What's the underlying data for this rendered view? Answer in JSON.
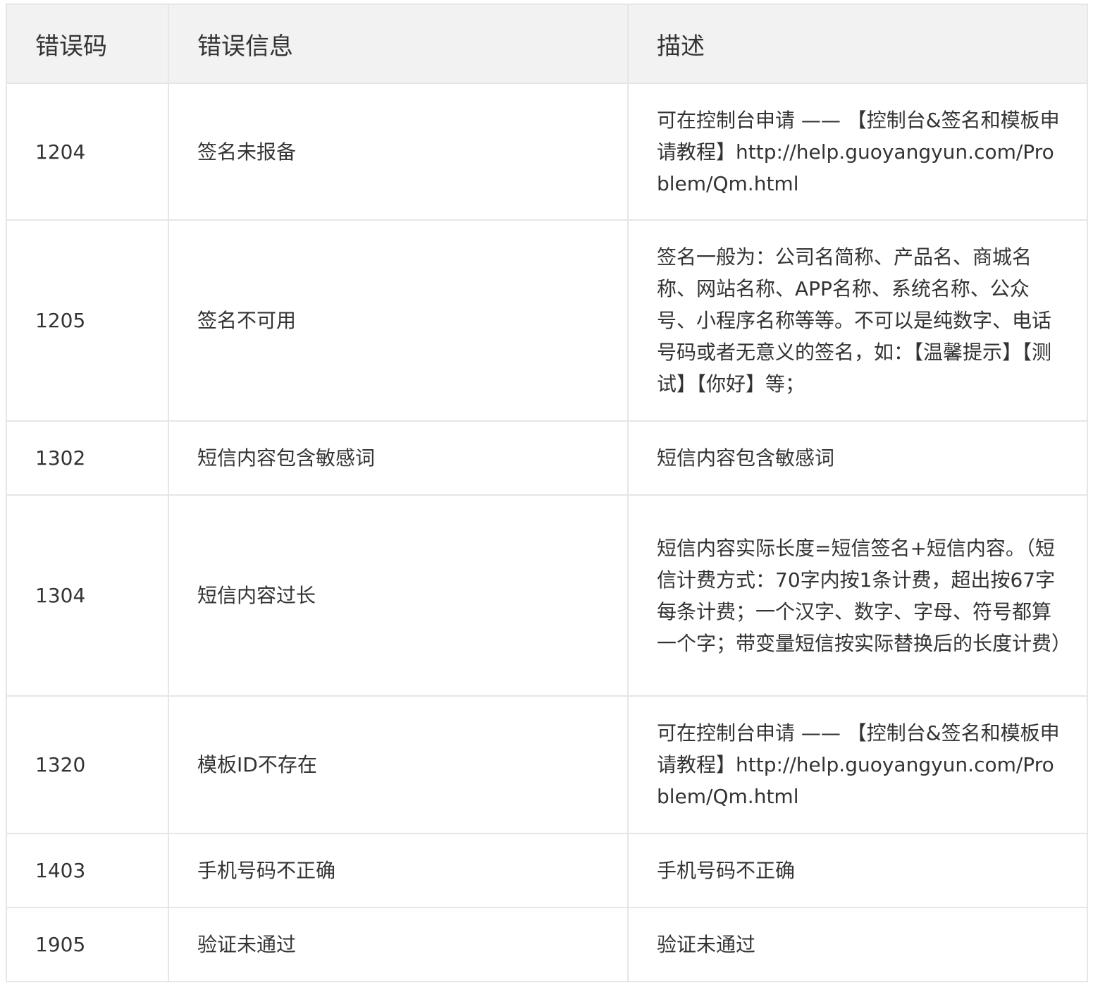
{
  "table": {
    "headers": [
      "错误码",
      "错误信息",
      "描述"
    ],
    "rows": [
      {
        "code": "1204",
        "message": "签名未报备",
        "description": "可在控制台申请 —— 【控制台&签名和模板申请教程】http://help.guoyangyun.com/Problem/Qm.html"
      },
      {
        "code": "1205",
        "message": "签名不可用",
        "description": "签名一般为：公司名简称、产品名、商城名称、网站名称、APP名称、系统名称、公众号、小程序名称等等。不可以是纯数字、电话号码或者无意义的签名，如：【温馨提示】【测试】【你好】等；"
      },
      {
        "code": "1302",
        "message": "短信内容包含敏感词",
        "description": "短信内容包含敏感词"
      },
      {
        "code": "1304",
        "message": "短信内容过长",
        "description": "短信内容实际长度=短信签名+短信内容。（短信计费方式：70字内按1条计费，超出按67字每条计费；一个汉字、数字、字母、符号都算一个字；带变量短信按实际替换后的长度计费）"
      },
      {
        "code": "1320",
        "message": "模板ID不存在",
        "description": "可在控制台申请 —— 【控制台&签名和模板申请教程】http://help.guoyangyun.com/Problem/Qm.html"
      },
      {
        "code": "1403",
        "message": "手机号码不正确",
        "description": "手机号码不正确"
      },
      {
        "code": "1905",
        "message": "验证未通过",
        "description": "验证未通过"
      }
    ]
  }
}
